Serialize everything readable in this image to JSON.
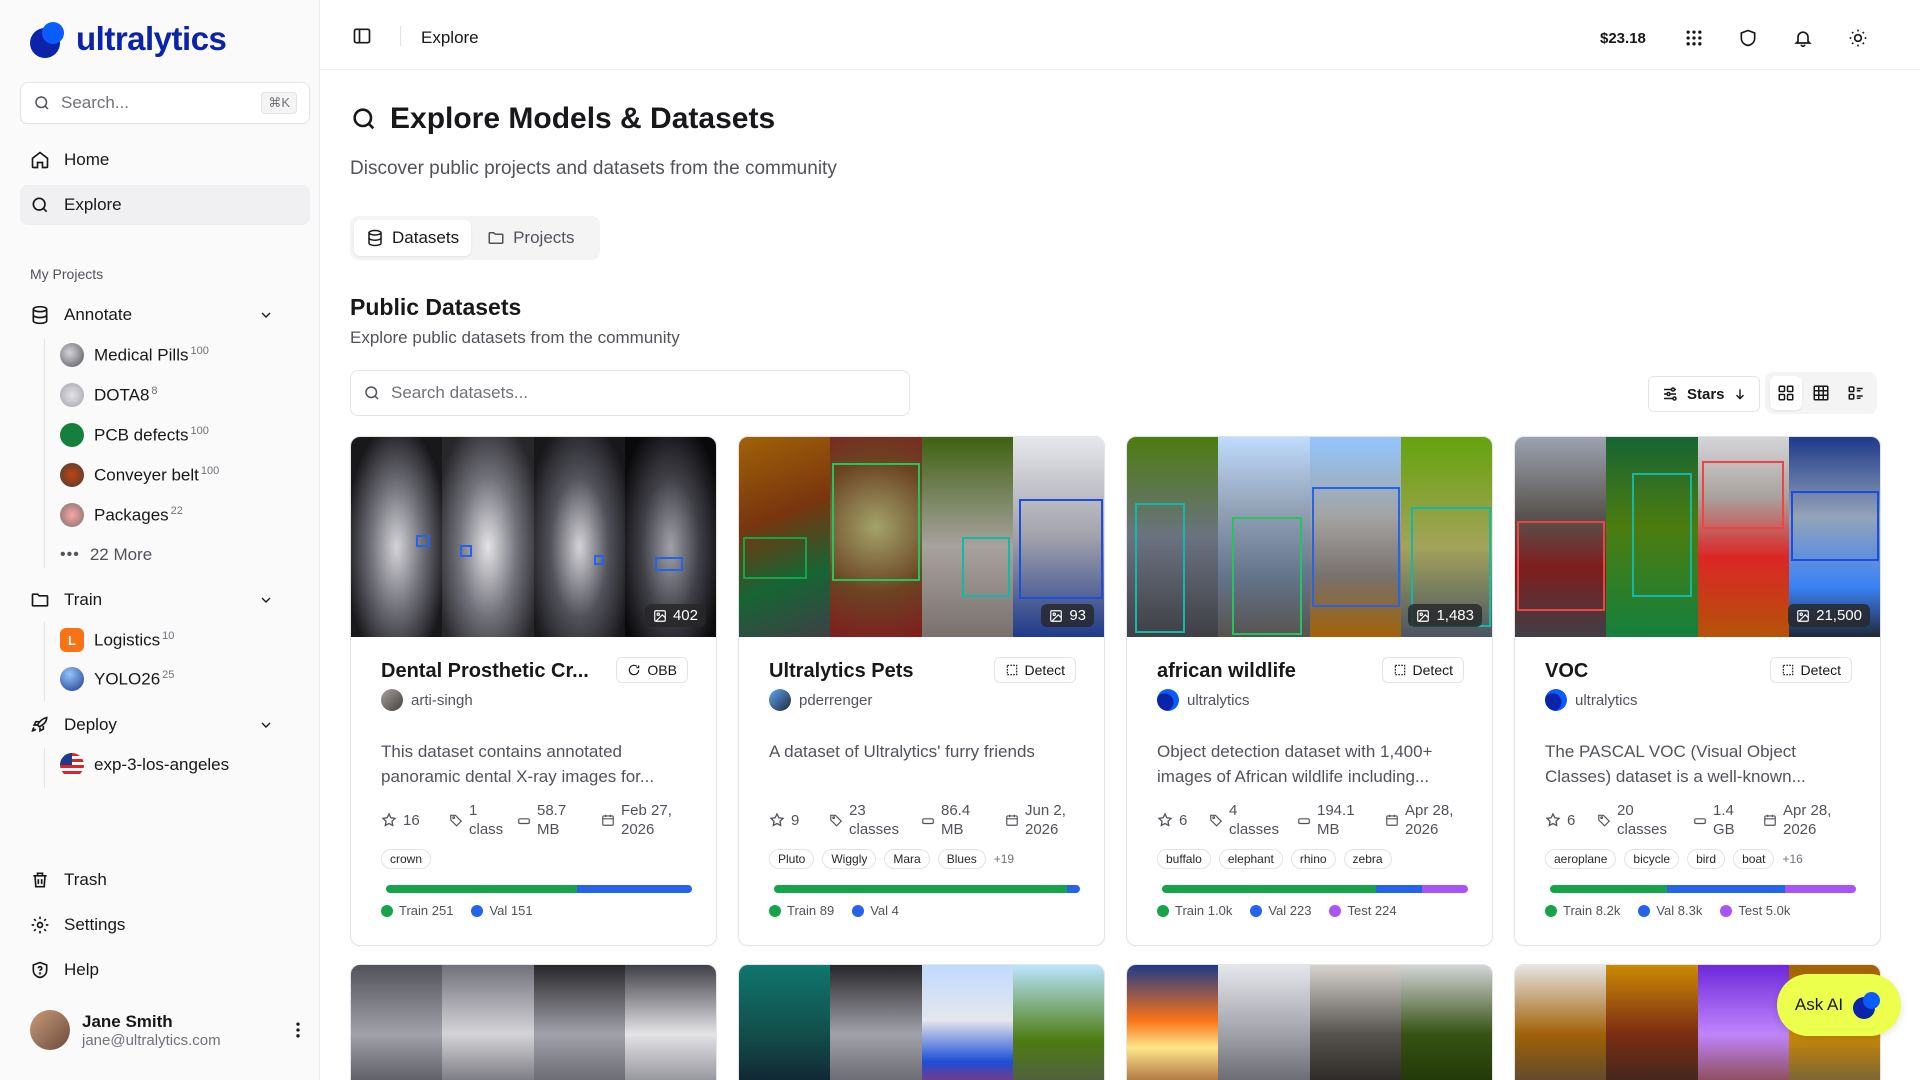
{
  "brand": {
    "name": "ultralytics",
    "accent": "#0b23a9"
  },
  "sidebar": {
    "search_placeholder": "Search...",
    "search_shortcut": "⌘K",
    "nav": [
      {
        "label": "Home",
        "icon": "home-icon"
      },
      {
        "label": "Explore",
        "icon": "search-icon"
      }
    ],
    "section": "My Projects",
    "annotate": {
      "label": "Annotate",
      "items": [
        {
          "label": "Medical Pills",
          "count": "100"
        },
        {
          "label": "DOTA8",
          "count": "8"
        },
        {
          "label": "PCB defects",
          "count": "100"
        },
        {
          "label": "Conveyer belt",
          "count": "100"
        },
        {
          "label": "Packages",
          "count": "22"
        }
      ],
      "more": "22 More"
    },
    "train": {
      "label": "Train",
      "items": [
        {
          "label": "Logistics",
          "count": "10",
          "initial": "L"
        },
        {
          "label": "YOLO26",
          "count": "25"
        }
      ]
    },
    "deploy": {
      "label": "Deploy",
      "items": [
        {
          "label": "exp-3-los-angeles"
        }
      ]
    },
    "bottom": [
      {
        "label": "Trash"
      },
      {
        "label": "Settings"
      },
      {
        "label": "Help"
      }
    ],
    "user": {
      "name": "Jane Smith",
      "email": "jane@ultralytics.com"
    }
  },
  "topbar": {
    "breadcrumb": "Explore",
    "credit": "$23.18"
  },
  "main": {
    "title": "Explore Models & Datasets",
    "subtitle": "Discover public projects and datasets from the community",
    "tabs": [
      {
        "label": "Datasets"
      },
      {
        "label": "Projects"
      }
    ],
    "section_title": "Public Datasets",
    "section_subtitle": "Explore public datasets from the community",
    "search_placeholder": "Search datasets...",
    "sort_label": "Stars"
  },
  "cards": [
    {
      "title": "Dental Prosthetic Cr...",
      "task": "OBB",
      "owner": "arti-singh",
      "images": "402",
      "description": "This dataset contains annotated panoramic dental X-ray images for...",
      "stars": "16",
      "classes_num": "1",
      "classes_word": "class",
      "size_num": "58.7",
      "size_unit": "MB",
      "date_line1": "Feb 27,",
      "date_line2": "2026",
      "tags": [
        "crown"
      ],
      "more_tags": "",
      "split": [
        {
          "label": "Train 251",
          "value": 251,
          "color": "#16a34a"
        },
        {
          "label": "Val 151",
          "value": 151,
          "color": "#2563eb"
        }
      ]
    },
    {
      "title": "Ultralytics Pets",
      "task": "Detect",
      "owner": "pderrenger",
      "images": "93",
      "description": "A dataset of Ultralytics' furry friends",
      "stars": "9",
      "classes_num": "23",
      "classes_word": "classes",
      "size_num": "86.4",
      "size_unit": "MB",
      "date_line1": "Jun 2,",
      "date_line2": "2026",
      "tags": [
        "Pluto",
        "Wiggly",
        "Mara",
        "Blues"
      ],
      "more_tags": "+19",
      "split": [
        {
          "label": "Train 89",
          "value": 89,
          "color": "#16a34a"
        },
        {
          "label": "Val 4",
          "value": 4,
          "color": "#2563eb"
        }
      ]
    },
    {
      "title": "african wildlife",
      "task": "Detect",
      "owner": "ultralytics",
      "images": "1,483",
      "description": "Object detection dataset with 1,400+ images of African wildlife including...",
      "stars": "6",
      "classes_num": "4",
      "classes_word": "classes",
      "size_num": "194.1",
      "size_unit": "MB",
      "date_line1": "Apr 28,",
      "date_line2": "2026",
      "tags": [
        "buffalo",
        "elephant",
        "rhino",
        "zebra"
      ],
      "more_tags": "",
      "split": [
        {
          "label": "Train 1.0k",
          "value": 1036,
          "color": "#16a34a"
        },
        {
          "label": "Val 223",
          "value": 223,
          "color": "#2563eb"
        },
        {
          "label": "Test 224",
          "value": 224,
          "color": "#a855f7"
        }
      ]
    },
    {
      "title": "VOC",
      "task": "Detect",
      "owner": "ultralytics",
      "images": "21,500",
      "description": "The PASCAL VOC (Visual Object Classes) dataset is a well-known...",
      "stars": "6",
      "classes_num": "20",
      "classes_word": "classes",
      "size_num": "1.4",
      "size_unit": "GB",
      "date_line1": "Apr 28,",
      "date_line2": "2026",
      "tags": [
        "aeroplane",
        "bicycle",
        "bird",
        "boat"
      ],
      "more_tags": "+16",
      "split": [
        {
          "label": "Train 8.2k",
          "value": 8200,
          "color": "#16a34a"
        },
        {
          "label": "Val 8.3k",
          "value": 8300,
          "color": "#2563eb"
        },
        {
          "label": "Test 5.0k",
          "value": 5000,
          "color": "#a855f7"
        }
      ]
    }
  ],
  "ask_ai": "Ask AI"
}
